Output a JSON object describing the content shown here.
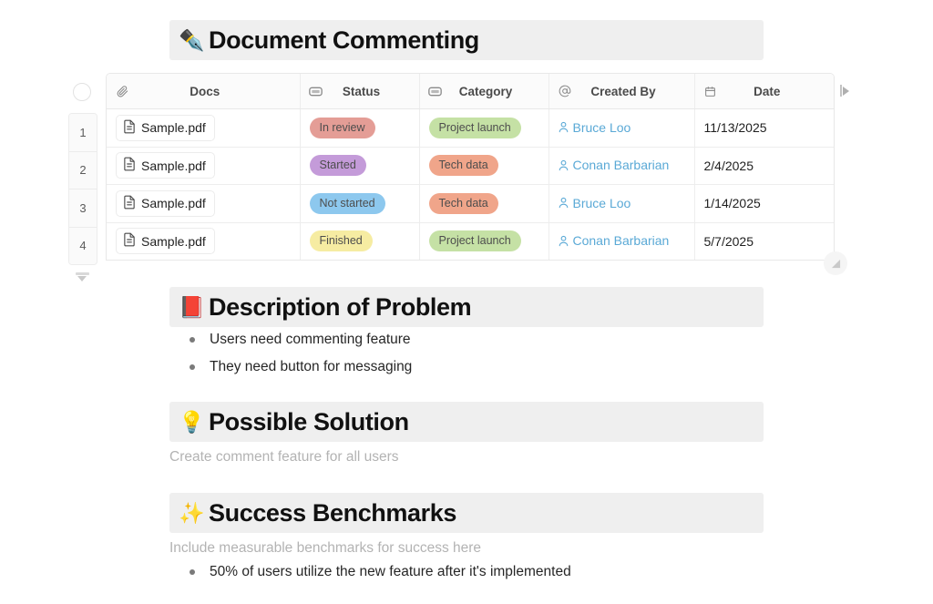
{
  "doc": {
    "title": "Document Commenting",
    "title_emoji": "✒️"
  },
  "table": {
    "select_all_name": "select-all-rows",
    "columns": [
      {
        "label": "Docs",
        "icon": "paperclip-icon"
      },
      {
        "label": "Status",
        "icon": "select-icon"
      },
      {
        "label": "Category",
        "icon": "select-icon"
      },
      {
        "label": "Created By",
        "icon": "mention-icon"
      },
      {
        "label": "Date",
        "icon": "calendar-icon"
      }
    ],
    "rows": [
      {
        "num": "1",
        "doc": "Sample.pdf",
        "status": "In review",
        "status_color": "#e49d96",
        "category": "Project launch",
        "category_color": "#c5e1a5",
        "created_by": "Bruce Loo",
        "date": "11/13/2025"
      },
      {
        "num": "2",
        "doc": "Sample.pdf",
        "status": "Started",
        "status_color": "#c49bd9",
        "category": "Tech data",
        "category_color": "#f0a58a",
        "created_by": "Conan Barbarian",
        "date": "2/4/2025"
      },
      {
        "num": "3",
        "doc": "Sample.pdf",
        "status": "Not started",
        "status_color": "#8dc8ee",
        "category": "Tech data",
        "category_color": "#f0a58a",
        "created_by": "Bruce Loo",
        "date": "1/14/2025"
      },
      {
        "num": "4",
        "doc": "Sample.pdf",
        "status": "Finished",
        "status_color": "#f6eca2",
        "category": "Project launch",
        "category_color": "#c5e1a5",
        "created_by": "Conan Barbarian",
        "date": "5/7/2025"
      }
    ],
    "link_color": "#5aa9d6"
  },
  "sections": {
    "description": {
      "emoji": "📕",
      "title": "Description of Problem",
      "bullets": [
        "Users need commenting feature",
        "They need button for messaging"
      ]
    },
    "solution": {
      "emoji": "💡",
      "title": "Possible Solution",
      "placeholder": "Create comment feature for all users"
    },
    "benchmarks": {
      "emoji": "✨",
      "title": "Success Benchmarks",
      "placeholder": "Include measurable benchmarks for success here",
      "bullets": [
        "50% of users utilize the new feature after it's implemented"
      ]
    }
  }
}
